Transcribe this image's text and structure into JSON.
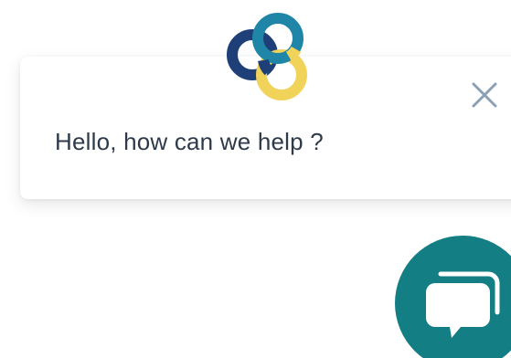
{
  "widget": {
    "greeting": "Hello, how can we help ?",
    "logo_icon": "interlocking-rings-logo-icon",
    "close_icon": "close-icon",
    "launcher_icon": "chat-bubbles-icon"
  },
  "colors": {
    "ring_navy": "#1f3f78",
    "ring_teal": "#1f86a8",
    "ring_yellow": "#f2d35a",
    "launcher_teal": "#137f84",
    "text": "#2e3a4a",
    "close_icon": "#8aa0b6"
  }
}
